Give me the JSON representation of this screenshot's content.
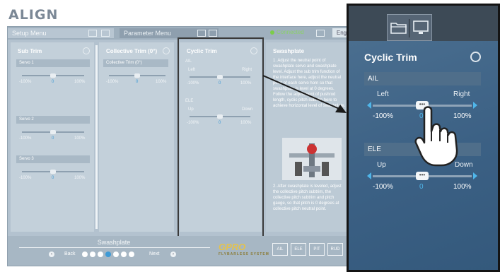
{
  "brand": {
    "logo": "ALIGN"
  },
  "tabs": {
    "setup": "Setup Menu",
    "parameter": "Parameter Menu",
    "status": "Connected",
    "language": "Eng"
  },
  "columns": {
    "sub_trim": {
      "title": "Sub Trim",
      "servos": [
        {
          "label": "Servo 1",
          "min": "-100%",
          "value": "0",
          "max": "100%",
          "level": 0
        },
        {
          "label": "Servo 2",
          "min": "-100%",
          "value": "0",
          "max": "100%",
          "level": 0
        },
        {
          "label": "Servo 3",
          "min": "-100%",
          "value": "0",
          "max": "100%",
          "level": 0
        }
      ]
    },
    "collective": {
      "title": "Collective Trim (0°)",
      "label": "Collective Trim (0°)",
      "min": "-100%",
      "value": "0",
      "max": "100%",
      "level": 0
    },
    "cyclic": {
      "title": "Cyclic Trim",
      "ail": {
        "label": "AIL",
        "left": "Left",
        "right": "Right",
        "min": "-100%",
        "value": "0",
        "max": "100%",
        "level": 0
      },
      "ele": {
        "label": "ELE",
        "left": "Up",
        "right": "Down",
        "min": "-100%",
        "value": "0",
        "max": "100%",
        "level": 0
      }
    },
    "swashplate": {
      "title": "Swashplate",
      "step1": "1. Adjust the neutral point of swashplate servo and swashplate level. Adjust the sub trim function of the interface here, adjust the neutral point of each servo horn so that swashplate is level at 0 degrees. Follow the adjustment of pushrod length, cyclic pitch subtrim here to achieve horizontal level of swashplate.",
      "step2": "2. After swashplate is leveled, adjust the collective pitch subtrim, the collective pitch subtrim and pitch gauge, so that pitch is 0 degrees at collective pitch neutral point."
    }
  },
  "footer": {
    "section": "Swashplate",
    "back": "Back",
    "next": "Next",
    "page_count": 7,
    "current_page": 4,
    "gpro_logo": "GPRO",
    "gpro_tagline": "FLYBARLESS SYSTEM",
    "buttons": [
      "AIL",
      "ELE",
      "PIT",
      "RUD"
    ]
  },
  "zoom": {
    "title": "Cyclic Trim",
    "ail": {
      "label": "AIL",
      "left": "Left",
      "right": "Right",
      "min": "-100%",
      "value": "0",
      "max": "100%",
      "level": 0
    },
    "ele": {
      "label": "ELE",
      "left": "Up",
      "right": "Down",
      "min": "-100%",
      "value": "0",
      "max": "100%",
      "level": 0
    }
  },
  "colors": {
    "accent": "#4fb6ea",
    "status": "#7ccd4a",
    "panel": "#3b6084",
    "frame": "#141414"
  },
  "icons": [
    "folder-icon",
    "monitor-icon",
    "reset-icon",
    "hand-pointer-icon",
    "arrow-icon"
  ]
}
